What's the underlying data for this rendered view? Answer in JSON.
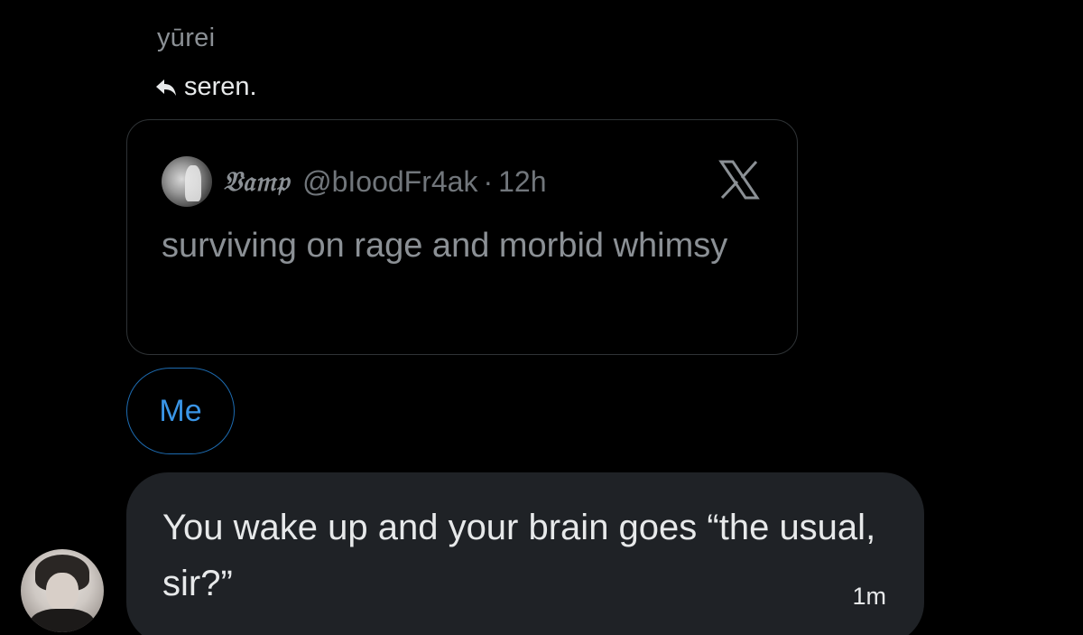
{
  "conversation": {
    "sender_name": "yūrei",
    "reply_to": "seren."
  },
  "quoted_post": {
    "display_name": "𝔙𝔞𝔪𝔭",
    "handle": "@bIoodFr4ak",
    "separator": "·",
    "time": "12h",
    "text": "surviving on rage and morbid whimsy",
    "logo_icon": "x-logo-icon"
  },
  "reaction_pill": {
    "label": "Me"
  },
  "message": {
    "text": "You wake up and your brain goes “the usual, sir?”",
    "time": "1m"
  },
  "colors": {
    "background": "#000000",
    "bubble": "#1f2226",
    "accent": "#3a95e6",
    "muted_text": "#8b9095"
  }
}
